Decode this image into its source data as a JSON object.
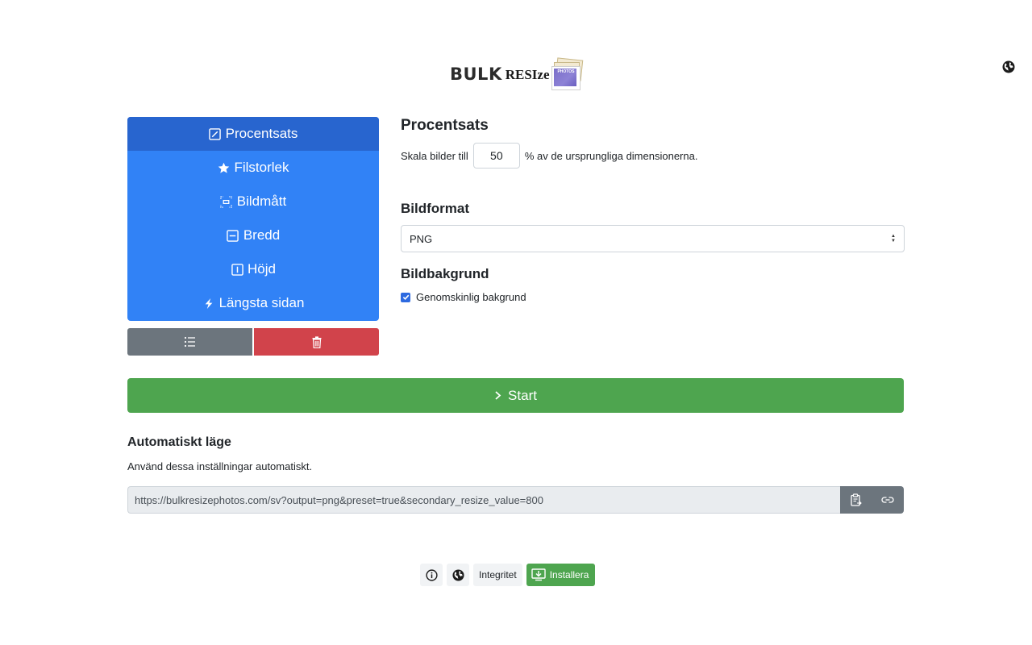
{
  "header": {
    "logo_bulk": "BULK",
    "logo_resize": "RESIze",
    "logo_photo_text": "PHOTOS",
    "lang_icon": "globe-icon"
  },
  "methods": {
    "items": [
      {
        "label": "Procentsats",
        "icon": "percent-square-icon",
        "active": true
      },
      {
        "label": "Filstorlek",
        "icon": "star-icon",
        "active": false
      },
      {
        "label": "Bildmått",
        "icon": "dimensions-icon",
        "active": false
      },
      {
        "label": "Bredd",
        "icon": "width-icon",
        "active": false
      },
      {
        "label": "Höjd",
        "icon": "height-icon",
        "active": false
      },
      {
        "label": "Längsta sidan",
        "icon": "lightning-icon",
        "active": false
      }
    ],
    "list_button_icon": "list-icon",
    "delete_button_icon": "trash-icon"
  },
  "settings": {
    "title": "Procentsats",
    "scale_prefix": "Skala bilder till",
    "scale_value": "50",
    "scale_suffix": "% av de ursprungliga dimensionerna.",
    "format_title": "Bildformat",
    "format_selected": "PNG",
    "background_title": "Bildbakgrund",
    "transparent_label": "Genomskinlig bakgrund",
    "transparent_checked": true
  },
  "start": {
    "label": "Start"
  },
  "auto": {
    "title": "Automatiskt läge",
    "description": "Använd dessa inställningar automatiskt.",
    "url": "https://bulkresizephotos.com/sv?output=png&preset=true&secondary_resize_value=800",
    "copy_icon": "clipboard-icon",
    "link_icon": "link-icon"
  },
  "footer": {
    "info_icon": "info-icon",
    "lang_icon": "globe-icon",
    "privacy_label": "Integritet",
    "install_label": "Installera",
    "install_icon": "install-icon"
  },
  "colors": {
    "primary": "#3182f6",
    "primary_active": "#2865cf",
    "secondary": "#6c757d",
    "danger": "#d1434b",
    "success": "#4ea54f"
  }
}
